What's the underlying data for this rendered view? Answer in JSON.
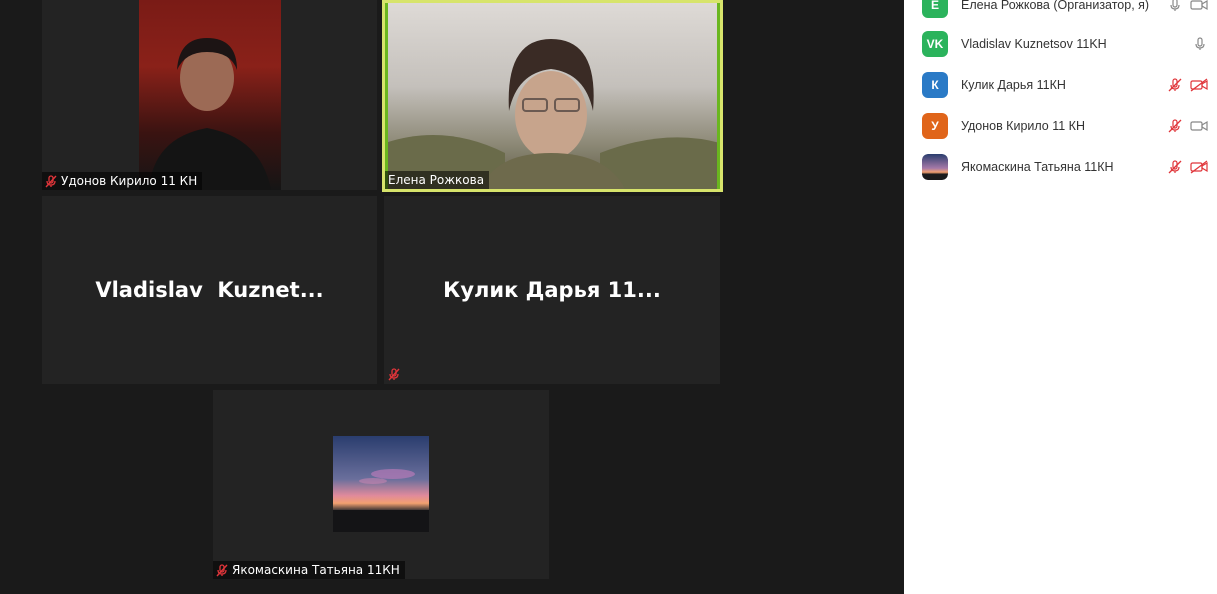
{
  "colors": {
    "stage_bg": "#1a1a1a",
    "tile_bg": "#232323",
    "active_speaker_border": "#d7e46b",
    "muted_red": "#e0353a",
    "panel_bg": "#ffffff"
  },
  "video_grid": {
    "tiles": [
      {
        "name_tag": "Удонов Кирило 11 КН",
        "muted": true,
        "video_on": true
      },
      {
        "name_tag": "Елена Рожкова",
        "muted": false,
        "video_on": true,
        "active_speaker": true
      },
      {
        "big_name": "Vladislav  Kuznet...",
        "muted": false,
        "video_on": false
      },
      {
        "big_name": "Кулик Дарья 11...",
        "muted": true,
        "video_on": false
      },
      {
        "name_tag": "Якомаскина Татьяна 11КН",
        "muted": true,
        "video_on": false
      }
    ]
  },
  "participants": [
    {
      "initials": "Е",
      "color": "#2bb35c",
      "name": "Елена Рожкова (Организатор, я)",
      "mic": "mic-icon",
      "cam": "camera-icon"
    },
    {
      "initials": "VK",
      "color": "#2bb35c",
      "name": "Vladislav Kuznetsov 11KH",
      "mic": "mic-icon",
      "cam": ""
    },
    {
      "initials": "К",
      "color": "#2a7ac6",
      "name": "Кулик Дарья 11КН",
      "mic": "mic-muted-icon",
      "cam": "camera-off-icon"
    },
    {
      "initials": "У",
      "color": "#e0651a",
      "name": "Удонов Кирило 11 КН",
      "mic": "mic-muted-icon",
      "cam": "camera-icon"
    },
    {
      "initials": "",
      "color": "#3b3a55",
      "name": "Якомаскина Татьяна 11КН",
      "mic": "mic-muted-icon",
      "cam": "camera-off-icon"
    }
  ]
}
